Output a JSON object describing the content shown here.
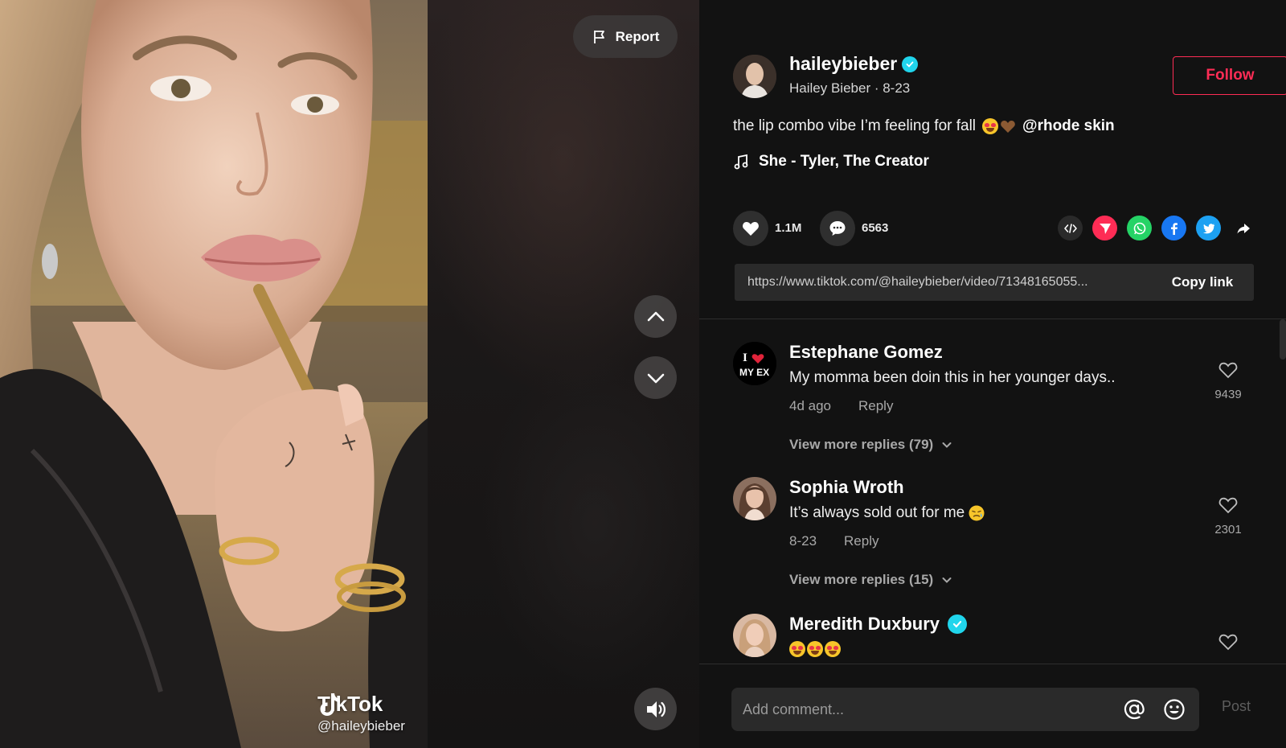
{
  "report": {
    "label": "Report"
  },
  "watermark": {
    "brand": "TikTok",
    "user": "@haileybieber"
  },
  "author": {
    "username": "haileybieber",
    "nickname": "Hailey Bieber",
    "date": "8-23",
    "meta_separator": " · ",
    "follow_label": "Follow"
  },
  "caption": {
    "text": "the lip combo vibe I’m feeling for fall",
    "mention": "@rhode skin"
  },
  "music": {
    "title": "She - Tyler, The Creator"
  },
  "stats": {
    "likes": "1.1M",
    "comments": "6563"
  },
  "share_icons": [
    "embed-icon",
    "send-icon",
    "whatsapp-icon",
    "facebook-icon",
    "twitter-icon",
    "share-arrow-icon"
  ],
  "link": {
    "url": "https://www.tiktok.com/@haileybieber/video/71348165055...",
    "copy_label": "Copy link"
  },
  "comments": [
    {
      "name": "Estephane Gomez",
      "text": "My momma been doin this in her younger days..",
      "time": "4d ago",
      "reply_label": "Reply",
      "likes": "9439",
      "view_more": "View more replies (79)",
      "avatar_text": {
        "line1": "I",
        "line2": "MY EX"
      }
    },
    {
      "name": "Sophia Wroth",
      "text": "It’s always sold out for me",
      "time": "8-23",
      "reply_label": "Reply",
      "likes": "2301",
      "view_more": "View more replies (15)"
    },
    {
      "name": "Meredith Duxbury",
      "verified": true
    }
  ],
  "composer": {
    "placeholder": "Add comment...",
    "post_label": "Post"
  },
  "colors": {
    "accent": "#fe2c55",
    "verified": "#20d5ec",
    "background": "#121212"
  }
}
